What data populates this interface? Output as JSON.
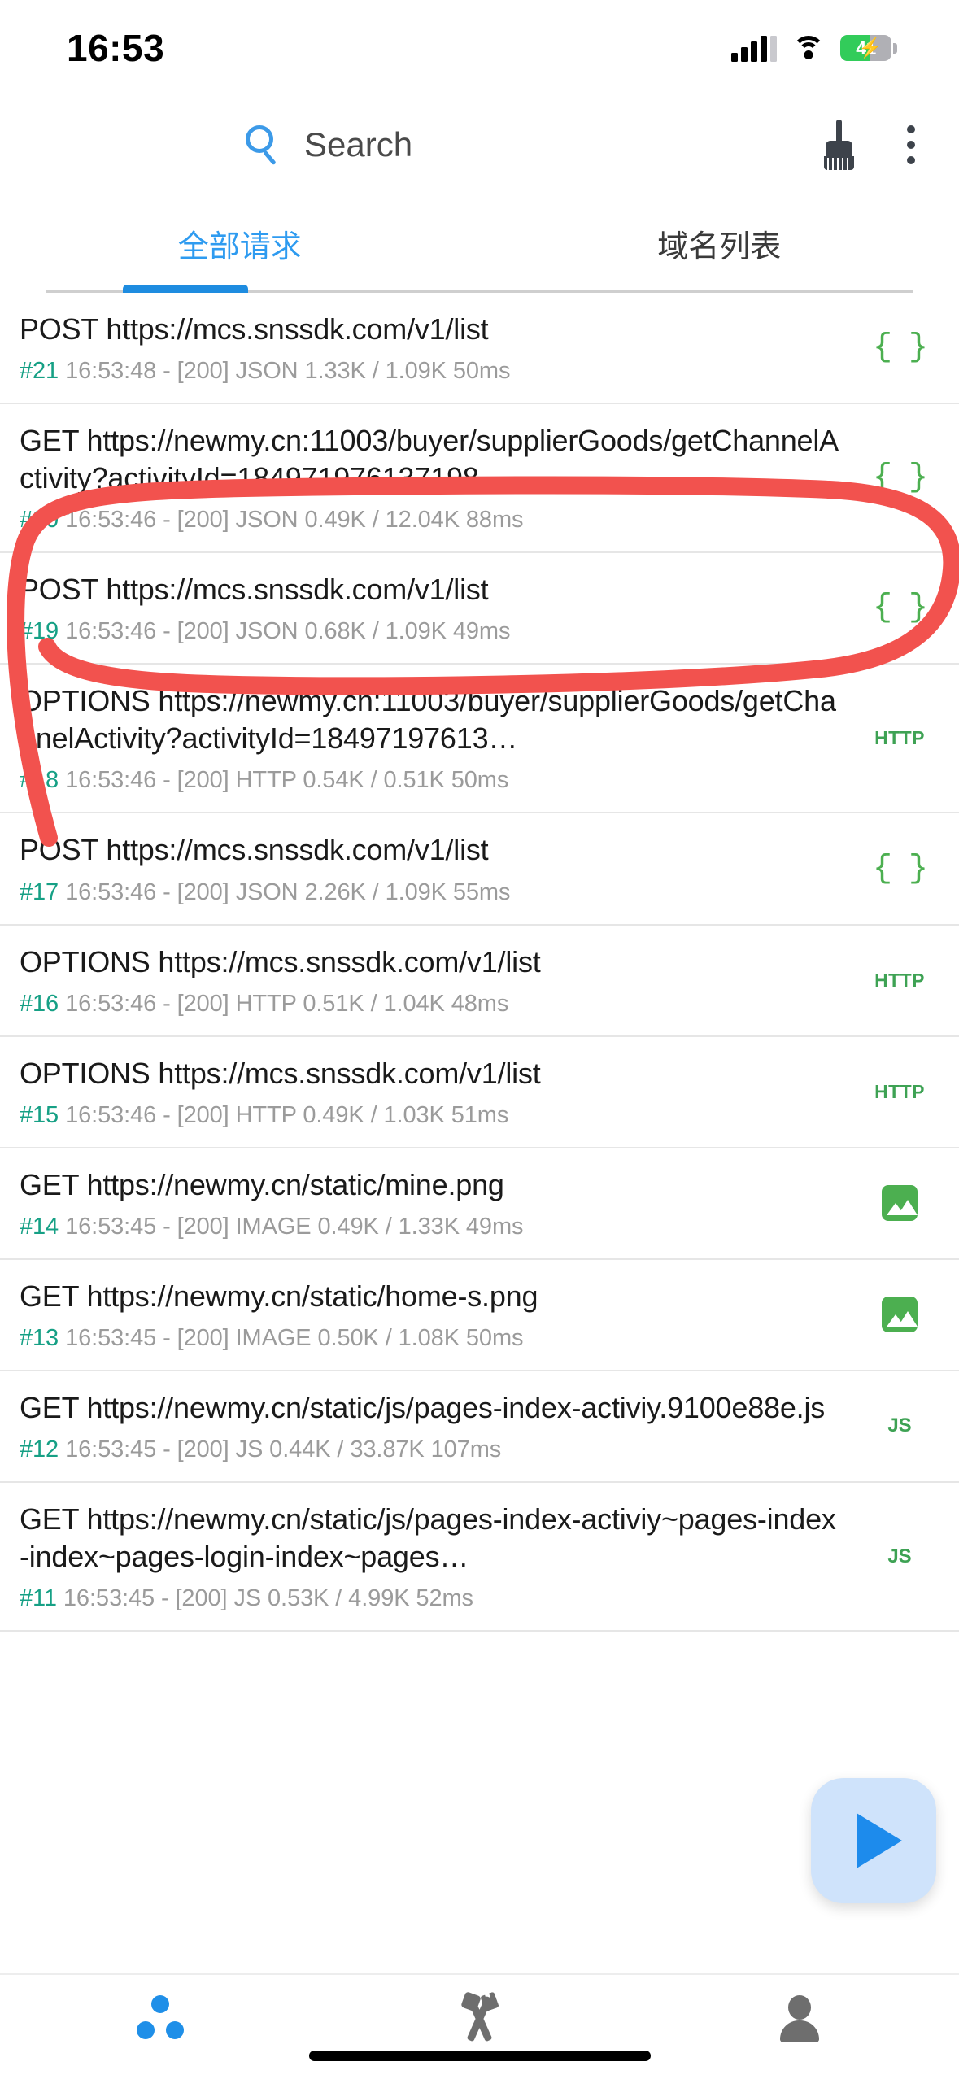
{
  "status_bar": {
    "time": "16:53",
    "battery_percent": "41",
    "battery_charging": true,
    "signal_icon": "cellular-signal-icon",
    "wifi_icon": "wifi-icon",
    "battery_icon": "battery-icon"
  },
  "app_bar": {
    "search_label": "Search",
    "search_icon": "search-icon",
    "clear_icon": "broom-clear-icon",
    "more_icon": "more-vertical-icon"
  },
  "tabs": [
    {
      "label": "全部请求",
      "active": true
    },
    {
      "label": "域名列表",
      "active": false
    }
  ],
  "colors": {
    "accent": "#2e9bf0",
    "tab_indicator": "#1e8ce0",
    "index_green": "#16a085",
    "type_green": "#4caf50",
    "meta_gray": "#9b9b9b",
    "annotation_red": "#f2524e",
    "fab_bg": "#cfe3fb",
    "fab_icon": "#1d8bec"
  },
  "requests": [
    {
      "method": "POST",
      "url": "https://mcs.snssdk.com/v1/list",
      "index": "#21",
      "meta": "16:53:48 - [200] JSON 1.33K / 1.09K  50ms",
      "type": "JSON",
      "icon": "json-braces-icon",
      "highlighted": false
    },
    {
      "method": "GET",
      "url": "https://newmy.cn:11003/buyer/supplierGoods/getChannelActivity?activityId=184971976137198…",
      "index": "#20",
      "meta": "16:53:46 - [200] JSON 0.49K / 12.04K  88ms",
      "type": "JSON",
      "icon": "json-braces-icon",
      "highlighted": true
    },
    {
      "method": "POST",
      "url": "https://mcs.snssdk.com/v1/list",
      "index": "#19",
      "meta": "16:53:46 - [200] JSON 0.68K / 1.09K  49ms",
      "type": "JSON",
      "icon": "json-braces-icon",
      "highlighted": false
    },
    {
      "method": "OPTIONS",
      "url": "https://newmy.cn:11003/buyer/supplierGoods/getChannelActivity?activityId=18497197613…",
      "index": "#18",
      "meta": "16:53:46 - [200] HTTP 0.54K / 0.51K  50ms",
      "type": "HTTP",
      "icon": "http-text-icon",
      "highlighted": false
    },
    {
      "method": "POST",
      "url": "https://mcs.snssdk.com/v1/list",
      "index": "#17",
      "meta": "16:53:46 - [200] JSON 2.26K / 1.09K  55ms",
      "type": "JSON",
      "icon": "json-braces-icon",
      "highlighted": false
    },
    {
      "method": "OPTIONS",
      "url": "https://mcs.snssdk.com/v1/list",
      "index": "#16",
      "meta": "16:53:46 - [200] HTTP 0.51K / 1.04K  48ms",
      "type": "HTTP",
      "icon": "http-text-icon",
      "highlighted": false
    },
    {
      "method": "OPTIONS",
      "url": "https://mcs.snssdk.com/v1/list",
      "index": "#15",
      "meta": "16:53:46 - [200] HTTP 0.49K / 1.03K  51ms",
      "type": "HTTP",
      "icon": "http-text-icon",
      "highlighted": false
    },
    {
      "method": "GET",
      "url": "https://newmy.cn/static/mine.png",
      "index": "#14",
      "meta": "16:53:45 - [200] IMAGE 0.49K / 1.33K  49ms",
      "type": "IMAGE",
      "icon": "image-thumbnail-icon",
      "highlighted": false
    },
    {
      "method": "GET",
      "url": "https://newmy.cn/static/home-s.png",
      "index": "#13",
      "meta": "16:53:45 - [200] IMAGE 0.50K / 1.08K  50ms",
      "type": "IMAGE",
      "icon": "image-thumbnail-icon",
      "highlighted": false
    },
    {
      "method": "GET",
      "url": "https://newmy.cn/static/js/pages-index-activiy.9100e88e.js",
      "index": "#12",
      "meta": "16:53:45 - [200] JS 0.44K / 33.87K  107ms",
      "type": "JS",
      "icon": "js-text-icon",
      "highlighted": false
    },
    {
      "method": "GET",
      "url": "https://newmy.cn/static/js/pages-index-activiy~pages-index-index~pages-login-index~pages…",
      "index": "#11",
      "meta": "16:53:45 - [200] JS 0.53K / 4.99K  52ms",
      "type": "JS",
      "icon": "js-text-icon",
      "highlighted": false
    }
  ],
  "fab": {
    "icon": "play-triangle-icon",
    "label": ""
  },
  "bottom_nav": [
    {
      "icon": "three-dots-group-icon",
      "active": true
    },
    {
      "icon": "tools-wrench-hammer-icon",
      "active": false
    },
    {
      "icon": "person-profile-icon",
      "active": false
    }
  ],
  "annotation": {
    "shape": "hand-drawn-red-circle",
    "targets_row_index": "#20"
  }
}
